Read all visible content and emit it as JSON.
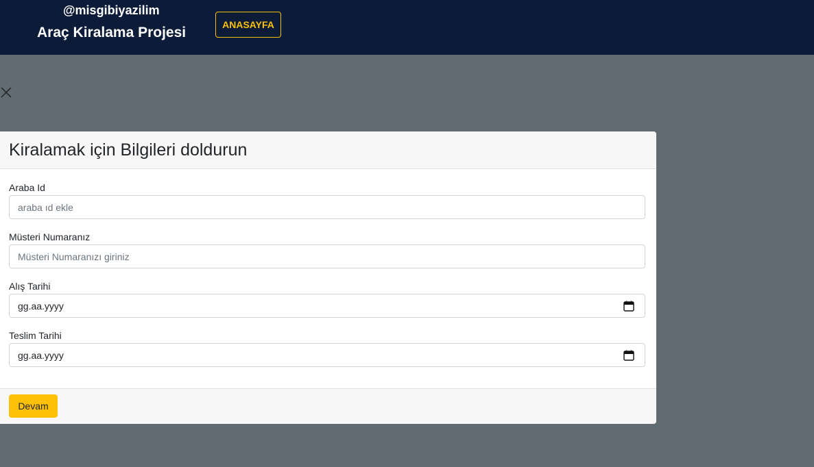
{
  "header": {
    "handle": "@misgibiyazilim",
    "title": "Araç Kiralama Projesi",
    "home_label": "ANASAYFA"
  },
  "modal": {
    "title": "Kiralamak için Bilgileri doldurun",
    "fields": [
      {
        "label": "Araba Id",
        "placeholder": "araba ıd ekle",
        "type": "text"
      },
      {
        "label": "Müsteri Numaranız",
        "placeholder": "Müsteri Numaranızı giriniz",
        "type": "text"
      },
      {
        "label": "Alış Tarihi",
        "placeholder": "gg.aa.yyyy",
        "type": "date"
      },
      {
        "label": "Teslim Tarihi",
        "placeholder": "gg.aa.yyyy",
        "type": "date"
      }
    ],
    "continue_label": "Devam"
  },
  "colors": {
    "navbar": "#0c1c38",
    "accent": "#ffc107",
    "backdrop": "#616c72"
  },
  "icons": {
    "close": "close-icon",
    "calendar": "calendar-icon"
  }
}
